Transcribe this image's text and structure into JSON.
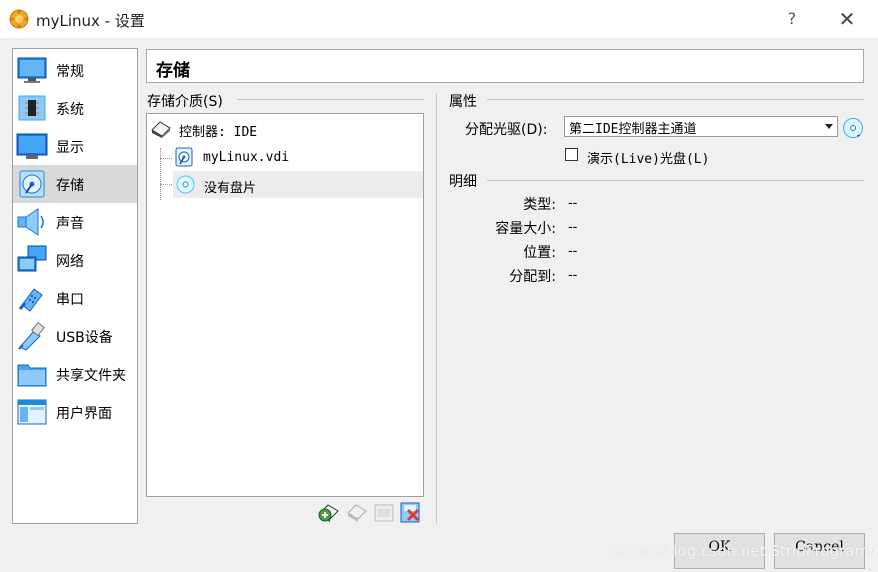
{
  "window": {
    "title": "myLinux - 设置",
    "help_label": "?",
    "close_label": "✕"
  },
  "sidebar": {
    "items": [
      {
        "label": "常规",
        "icon": "monitor-icon"
      },
      {
        "label": "系统",
        "icon": "chip-icon"
      },
      {
        "label": "显示",
        "icon": "display-icon"
      },
      {
        "label": "存储",
        "icon": "disk-icon",
        "selected": true
      },
      {
        "label": "声音",
        "icon": "speaker-icon"
      },
      {
        "label": "网络",
        "icon": "network-icon"
      },
      {
        "label": "串口",
        "icon": "serial-port-icon"
      },
      {
        "label": "USB设备",
        "icon": "usb-icon"
      },
      {
        "label": "共享文件夹",
        "icon": "folder-icon"
      },
      {
        "label": "用户界面",
        "icon": "window-icon"
      }
    ]
  },
  "page": {
    "title": "存储"
  },
  "storage": {
    "section_label": "存储介质(S)",
    "tree": {
      "controller": "控制器: IDE",
      "items": [
        "myLinux.vdi",
        "没有盘片"
      ]
    }
  },
  "attributes": {
    "section_label": "属性",
    "drive_label": "分配光驱(D):",
    "drive_value": "第二IDE控制器主通道",
    "live_cd_label": "演示(Live)光盘(L)",
    "live_cd_checked": false
  },
  "info": {
    "section_label": "明细",
    "rows": [
      {
        "key": "类型:",
        "value": "--"
      },
      {
        "key": "容量大小:",
        "value": "--"
      },
      {
        "key": "位置:",
        "value": "--"
      },
      {
        "key": "分配到:",
        "value": "--"
      }
    ]
  },
  "buttons": {
    "ok": "OK",
    "cancel": "Cancel"
  },
  "watermark": "https://blog.csdn.net/StripProgrammer"
}
